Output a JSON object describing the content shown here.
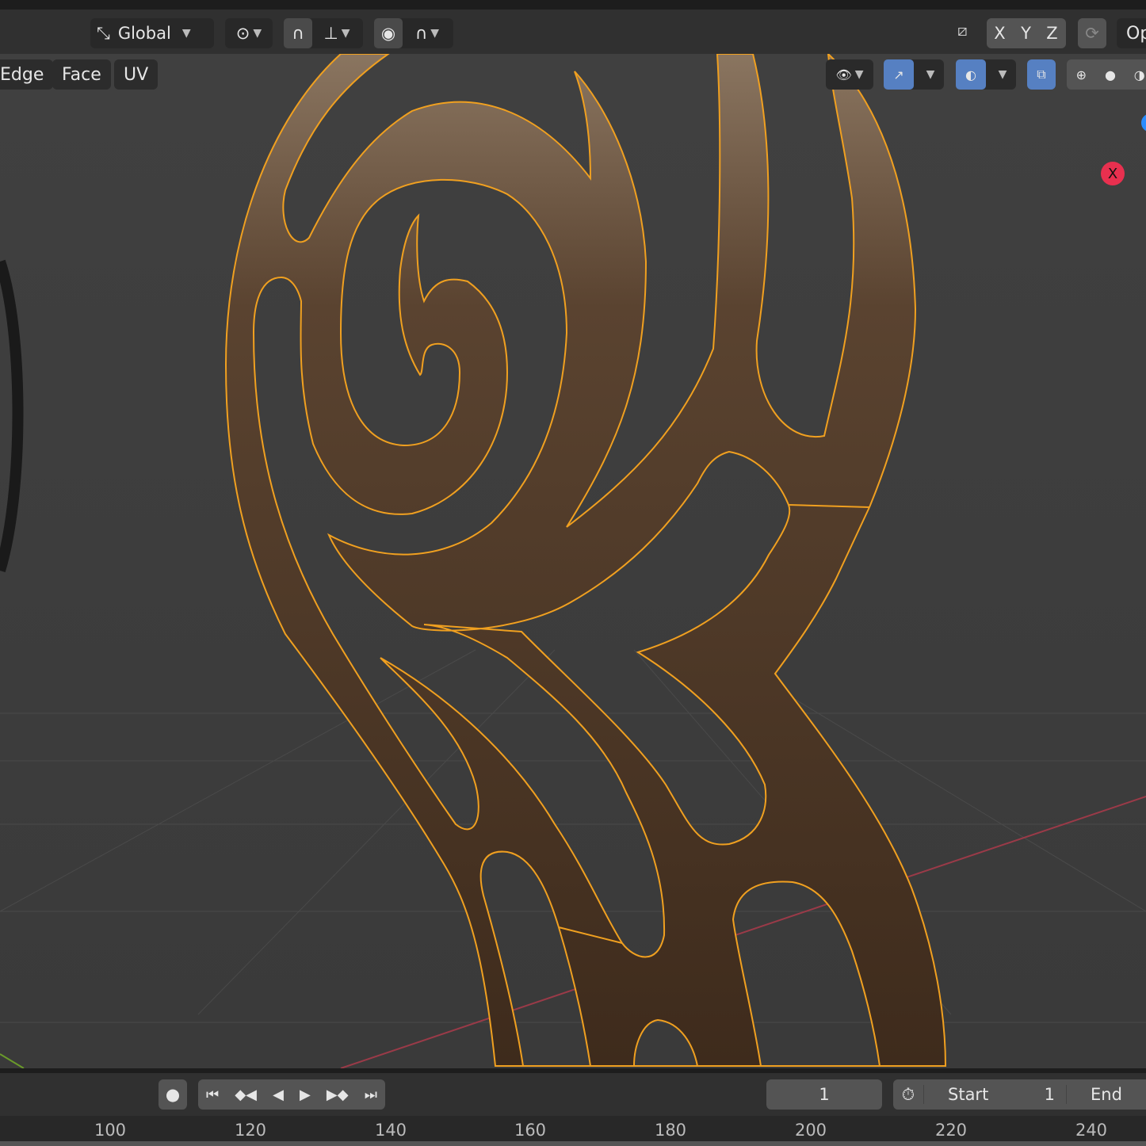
{
  "header": {
    "orientation": "Global",
    "axes": [
      "X",
      "Y",
      "Z"
    ],
    "options_label": "Op"
  },
  "select_modes": [
    "Edge",
    "Face",
    "UV"
  ],
  "viewport": {
    "gizmo_x_label": "X",
    "mesh_fill": "#4a3420",
    "edge_color": "#f0a020",
    "accent": "#5680c2"
  },
  "timeline": {
    "current_frame": "1",
    "start_label": "Start",
    "start_value": "1",
    "end_label": "End"
  },
  "ruler": {
    "ticks": [
      "100",
      "120",
      "140",
      "160",
      "180",
      "200",
      "220",
      "240"
    ]
  }
}
